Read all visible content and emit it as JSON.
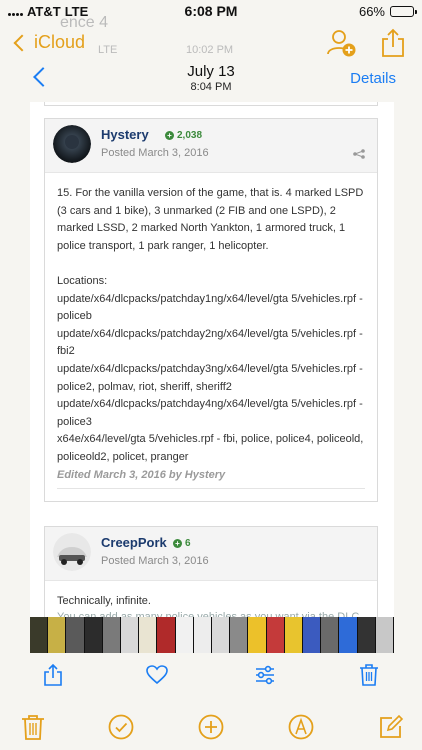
{
  "status_bar": {
    "carrier": "AT&T",
    "network": "LTE",
    "time": "6:08 PM",
    "battery_percent": "66%",
    "battery_level": 0.66
  },
  "app_nav": {
    "back_label": "iCloud",
    "ghost_texts": [
      "ence 4",
      "LTE",
      "10:02 PM"
    ]
  },
  "message": {
    "date": "July 13",
    "time": "8:04 PM",
    "details_label": "Details"
  },
  "posts": [
    {
      "author": "Hystery",
      "reputation": "2,038",
      "posted": "Posted March 3, 2016",
      "body": "15. For the vanilla version of the game, that is. 4 marked LSPD (3 cars and 1 bike), 3 unmarked (2 FIB and one LSPD), 2 marked LSSD, 2 marked North Yankton, 1 armored truck, 1 police transport, 1 park ranger, 1 helicopter.\n\nLocations:\nupdate/x64/dlcpacks/patchday1ng/x64/level/gta 5/vehicles.rpf - policeb\nupdate/x64/dlcpacks/patchday2ng/x64/level/gta 5/vehicles.rpf - fbi2\nupdate/x64/dlcpacks/patchday3ng/x64/level/gta 5/vehicles.rpf - police2, polmav, riot, sheriff, sheriff2\nupdate/x64/dlcpacks/patchday4ng/x64/level/gta 5/vehicles.rpf - police3\nx64e/x64/level/gta 5/vehicles.rpf - fbi, police, police4, policeold, policeold2, policet, pranger",
      "edited": "Edited March 3, 2016 by Hystery"
    },
    {
      "author": "CreepPork",
      "reputation": "6",
      "posted": "Posted March 3, 2016",
      "body": "Technically, infinite.",
      "cut_line": "You can add as many police vehicles as you want via the DLC"
    }
  ],
  "icons": {
    "status": [
      "signal-icon",
      "battery-icon"
    ],
    "nav": [
      "chevron-left-icon",
      "add-person-icon",
      "share-icon"
    ],
    "post": [
      "avatar",
      "rep-plus-icon",
      "share-small-icon"
    ],
    "photo_toolbar": [
      "share-icon",
      "heart-icon",
      "adjust-icon",
      "trash-icon"
    ],
    "notes_toolbar": [
      "trash-icon",
      "checkmark-icon",
      "plus-icon",
      "markup-pen-icon",
      "compose-icon"
    ]
  },
  "thumbnails": [
    "#3a3a2a",
    "#c7b046",
    "#5a5a5a",
    "#2c2c2c",
    "#7a7a7a",
    "#d8d8d8",
    "#e9e4d2",
    "#b02a2a",
    "#f1f1f1",
    "#ededed",
    "#d9d9d9",
    "#8a8a8a",
    "#ecc12a",
    "#c43a3a",
    "#e8c42e",
    "#3b5bbf",
    "#6a6a6a",
    "#2e6bd8",
    "#333333",
    "#c8c8c8"
  ],
  "colors": {
    "accent_gold": "#e4a01b",
    "accent_blue": "#1b7df3",
    "author": "#1c3b6e",
    "rep_green": "#3c8a3c"
  }
}
